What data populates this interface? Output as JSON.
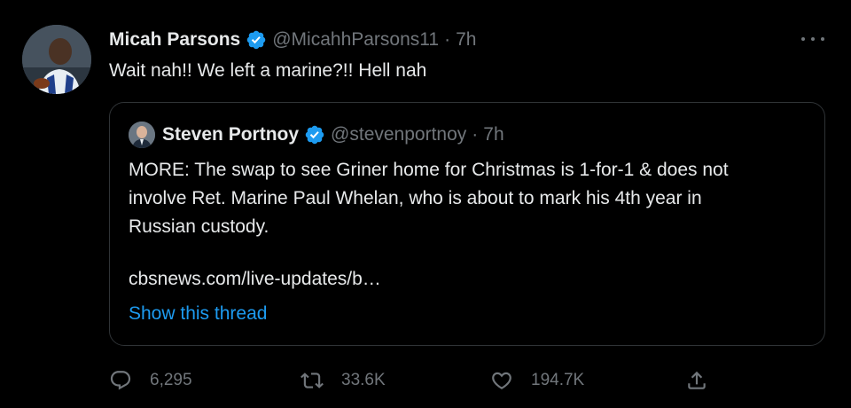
{
  "tweet": {
    "author_name": "Micah Parsons",
    "handle": "@MicahhParsons11",
    "separator": "·",
    "time": "7h",
    "text": "Wait nah!! We left a marine?!! Hell nah"
  },
  "quote": {
    "author_name": "Steven Portnoy",
    "handle": "@stevenportnoy",
    "separator": "·",
    "time": "7h",
    "lines": [
      "MORE: The swap to see Griner home for Christmas is 1-for-1 & does not",
      "involve Ret. Marine Paul Whelan, who is about to mark his 4th year in",
      "Russian custody."
    ],
    "link": "cbsnews.com/live-updates/b…",
    "show_thread": "Show this thread"
  },
  "actions": {
    "replies": "6,295",
    "retweets": "33.6K",
    "likes": "194.7K"
  },
  "icons": {
    "verified": "verified-badge-icon",
    "more": "more-icon",
    "reply": "reply-icon",
    "retweet": "retweet-icon",
    "like": "heart-icon",
    "share": "share-icon"
  },
  "colors": {
    "background": "#000000",
    "text": "#e7e9ea",
    "secondary": "#71767b",
    "accent": "#1d9bf0",
    "border": "#2f3336"
  }
}
